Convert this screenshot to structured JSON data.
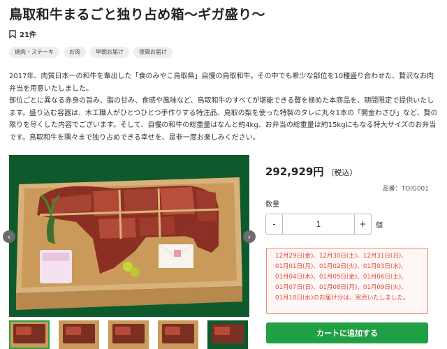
{
  "product": {
    "title": "鳥取和牛まるごと独り占め箱〜ギガ盛り〜",
    "favorites": "21件",
    "tags": [
      "焼肉・ステーキ",
      "お肉",
      "早朝お届け",
      "夜間お届け"
    ],
    "description": [
      "2017年、肉質日本一の和牛を輩出した「食のみやこ鳥取県」自慢の鳥取和牛。その中でも希少な部位を10種盛り合わせた、贅沢なお肉弁当を用意いたしました。",
      "部位ごとに異なる赤身の旨み、脂の甘み、食感や風味など、鳥取和牛のすべてが堪能できる贅を極めた本商品を、期間限定で提供いたします。盛り込む容器は、木工職人がひとつひとつ手作りする特注品、鳥取の梨を使った特製のタレに丸々1本の「開金わさび」など、贅の限りを尽くした内容でございます。そして、自慢の和牛の総重量はなんと約4kg、お弁当の総重量は約15kgにもなる特大サイズのお弁当です。鳥取和牛を隅々まで独り占めできる幸せを、是非一度お楽しみください。"
    ],
    "price": "292,929円",
    "tax_label": "（税込）",
    "sku": "品番：TOIG001",
    "quantity_label": "数量",
    "quantity_value": "1",
    "quantity_minus": "-",
    "quantity_plus": "+",
    "quantity_unit": "個",
    "notice_lines": [
      "12月29日(金)、12月30日(土)、12月31日(日)、",
      "01月01日(月)、01月02日(火)、01月03日(水)、",
      "01月04日(木)、01月05日(金)、01月06日(土)、",
      "01月07日(日)、01月08日(月)、01月09日(火)、",
      "01月10日(水)のお届け分は、完売いたしました。"
    ],
    "cart_button": "カートに追加する"
  },
  "gallery": {
    "prev_icon": "‹",
    "next_icon": "›"
  },
  "colors": {
    "accent_green": "#20a045",
    "notice_red": "#d94a3a",
    "notice_border": "#e8897a"
  }
}
